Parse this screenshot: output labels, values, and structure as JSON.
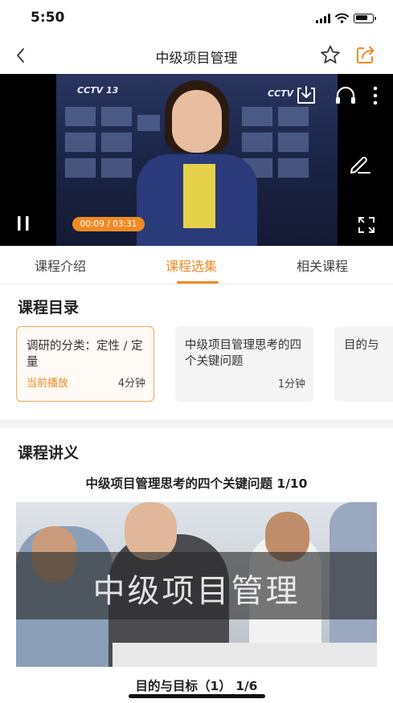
{
  "status_bar": {
    "time": "5:50"
  },
  "nav": {
    "title": "中级项目管理"
  },
  "video": {
    "logo_left": "CCTV 13",
    "logo_right": "CCTV",
    "time_display": "00:09 / 03:31",
    "progress": 0.043
  },
  "tabs": [
    {
      "label": "课程介绍",
      "active": false
    },
    {
      "label": "课程选集",
      "active": true
    },
    {
      "label": "相关课程",
      "active": false
    }
  ],
  "catalog": {
    "title": "课程目录",
    "lessons": [
      {
        "title": "调研的分类：定性 / 定量",
        "status": "当前播放",
        "duration": "4分钟",
        "current": true
      },
      {
        "title": "中级项目管理思考的四个关键问题",
        "status": "",
        "duration": "1分钟",
        "current": false
      },
      {
        "title": "目的与",
        "status": "",
        "duration": "",
        "current": false
      }
    ]
  },
  "handout": {
    "title": "课程讲义",
    "doc_title": "中级项目管理思考的四个关键问题 1/10",
    "slide_text": "中级项目管理",
    "caption": "目的与目标（1） 1/6"
  },
  "colors": {
    "accent": "#f08a24",
    "card_border": "#f0a55c"
  }
}
